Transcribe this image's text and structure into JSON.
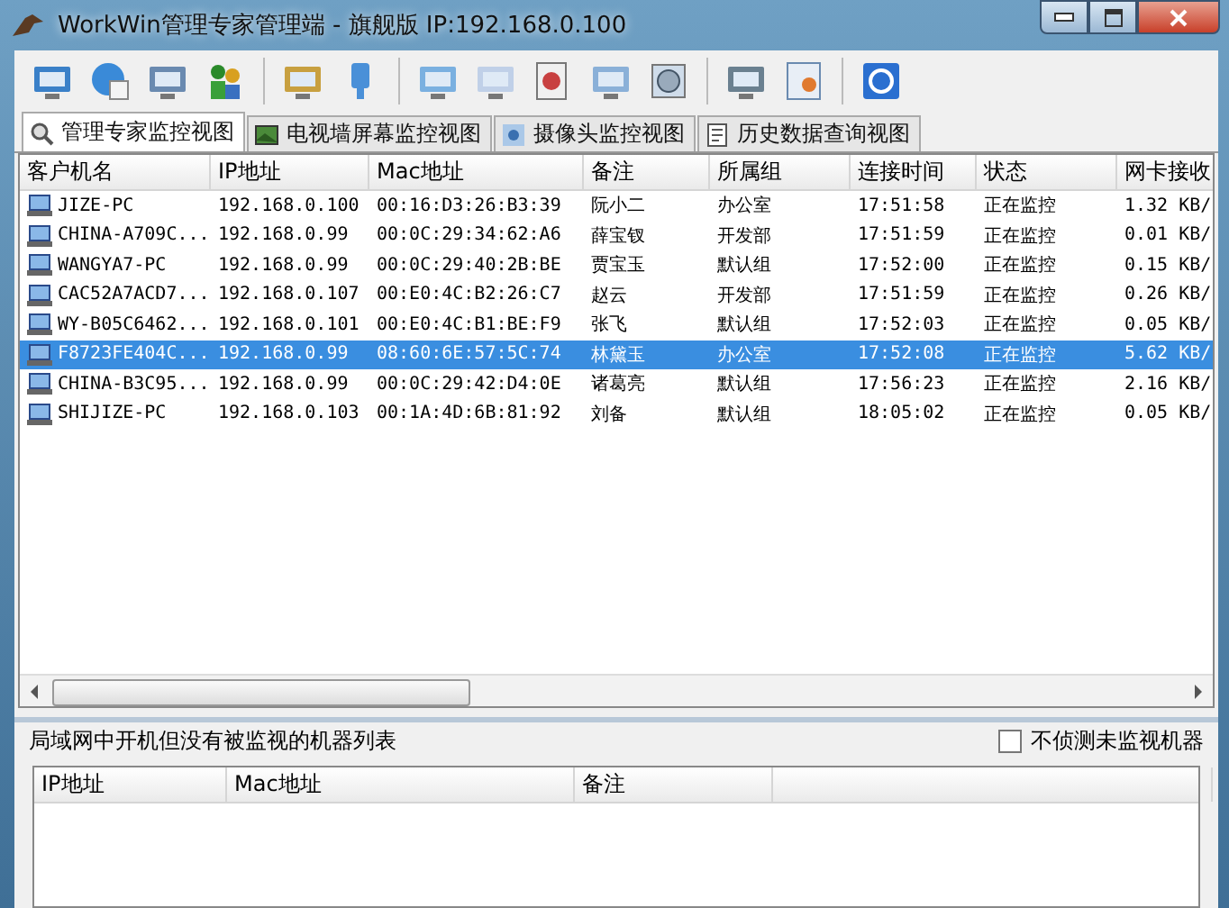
{
  "window": {
    "title": "WorkWin管理专家管理端 - 旗舰版 IP:192.168.0.100"
  },
  "tabs": [
    {
      "label": "管理专家监控视图",
      "selected": true
    },
    {
      "label": "电视墙屏幕监控视图",
      "selected": false
    },
    {
      "label": "摄像头监控视图",
      "selected": false
    },
    {
      "label": "历史数据查询视图",
      "selected": false
    }
  ],
  "table": {
    "columns": [
      "客户机名",
      "IP地址",
      "Mac地址",
      "备注",
      "所属组",
      "连接时间",
      "状态",
      "网卡接收"
    ],
    "rows": [
      {
        "cells": [
          "JIZE-PC",
          "192.168.0.100",
          "00:16:D3:26:B3:39",
          "阮小二",
          "办公室",
          "17:51:58",
          "正在监控",
          "1.32 KB/"
        ],
        "selected": false
      },
      {
        "cells": [
          "CHINA-A709C...",
          "192.168.0.99",
          "00:0C:29:34:62:A6",
          "薛宝钗",
          "开发部",
          "17:51:59",
          "正在监控",
          "0.01 KB/"
        ],
        "selected": false
      },
      {
        "cells": [
          "WANGYA7-PC",
          "192.168.0.99",
          "00:0C:29:40:2B:BE",
          "贾宝玉",
          "默认组",
          "17:52:00",
          "正在监控",
          "0.15 KB/"
        ],
        "selected": false
      },
      {
        "cells": [
          "CAC52A7ACD7...",
          "192.168.0.107",
          "00:E0:4C:B2:26:C7",
          "赵云",
          "开发部",
          "17:51:59",
          "正在监控",
          "0.26 KB/"
        ],
        "selected": false
      },
      {
        "cells": [
          "WY-B05C6462...",
          "192.168.0.101",
          "00:E0:4C:B1:BE:F9",
          "张飞",
          "默认组",
          "17:52:03",
          "正在监控",
          "0.05 KB/"
        ],
        "selected": false
      },
      {
        "cells": [
          "F8723FE404C...",
          "192.168.0.99",
          "08:60:6E:57:5C:74",
          "林黛玉",
          "办公室",
          "17:52:08",
          "正在监控",
          "5.62 KB/"
        ],
        "selected": true
      },
      {
        "cells": [
          "CHINA-B3C95...",
          "192.168.0.99",
          "00:0C:29:42:D4:0E",
          "诸葛亮",
          "默认组",
          "17:56:23",
          "正在监控",
          "2.16 KB/"
        ],
        "selected": false
      },
      {
        "cells": [
          "SHIJIZE-PC",
          "192.168.0.103",
          "00:1A:4D:6B:81:92",
          "刘备",
          "默认组",
          "18:05:02",
          "正在监控",
          "0.05 KB/"
        ],
        "selected": false
      }
    ]
  },
  "unmonitored": {
    "title": "局域网中开机但没有被监视的机器列表",
    "checkbox": {
      "label": "不侦测未监视机器",
      "checked": false
    },
    "columns": [
      "IP地址",
      "Mac地址",
      "备注"
    ]
  }
}
